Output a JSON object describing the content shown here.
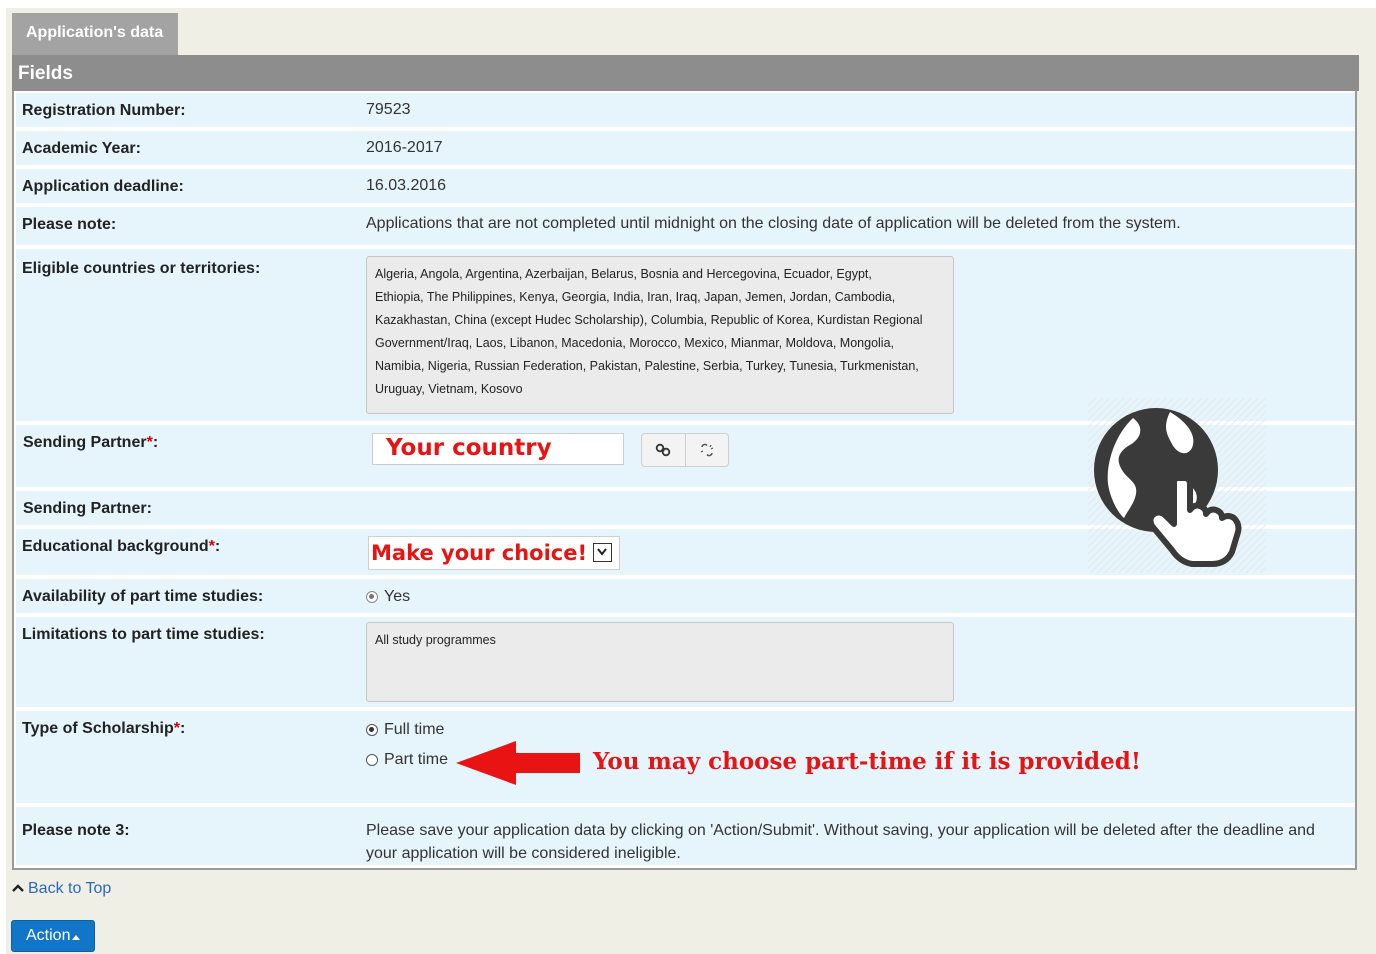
{
  "tab": {
    "label": "Application's data"
  },
  "section": {
    "title": "Fields"
  },
  "rows": {
    "registration_number": {
      "label": "Registration Number:",
      "value": "79523"
    },
    "academic_year": {
      "label": "Academic Year:",
      "value": "2016-2017"
    },
    "deadline": {
      "label": "Application deadline:",
      "value": "16.03.2016"
    },
    "please_note": {
      "label": "Please note:",
      "value": "Applications that are not completed until midnight on the closing date of application will be deleted from the system."
    },
    "eligible": {
      "label": "Eligible countries or territories:",
      "lines": [
        "Algeria, Angola, Argentina, Azerbaijan, Belarus, Bosnia and Hercegovina, Ecuador, Egypt,",
        "Ethiopia, The Philippines, Kenya, Georgia, India, Iran, Iraq, Japan, Jemen, Jordan, Cambodia,",
        "Kazakhastan, China (except Hudec Scholarship), Columbia, Republic of Korea, Kurdistan Regional",
        "Government/Iraq, Laos, Libanon, Macedonia, Morocco, Mexico, Mianmar, Moldova, Mongolia,",
        "Namibia, Nigeria, Russian Federation, Pakistan, Palestine, Serbia, Turkey, Tunesia, Turkmenistan,",
        "Uruguay, Vietnam, Kosovo"
      ]
    },
    "sending_partner_input": {
      "label": "Sending Partner",
      "req": "*",
      "colon": ":",
      "value": "Your country"
    },
    "sending_partner": {
      "label": "Sending Partner:"
    },
    "education": {
      "label": "Educational background",
      "req": "*",
      "colon": ":",
      "selected": "Make your choice!"
    },
    "part_time_avail": {
      "label": "Availability of part time studies:",
      "option": "Yes"
    },
    "limitations": {
      "label": "Limitations to part time studies:",
      "value": "All study programmes"
    },
    "scholarship": {
      "label": "Type of Scholarship",
      "req": "*",
      "colon": ":",
      "options": [
        "Full time",
        "Part time"
      ],
      "annotation": "You may choose part-time if it is provided!"
    },
    "please_note_3": {
      "label": "Please note 3:",
      "lines": [
        "Please save your application data by clicking on 'Action/Submit'. Without saving, your application will be deleted after the deadline and",
        "your application will be considered ineligible."
      ]
    }
  },
  "footer": {
    "back_to_top": "Back to Top",
    "action": "Action"
  },
  "icons": {
    "globe": "globe-hand-icon",
    "link": "link-icon",
    "unlink": "unlink-icon"
  },
  "colors": {
    "annotation": "#e81414",
    "action_button": "#1276c8",
    "row_bg": "#e6f4fb"
  }
}
